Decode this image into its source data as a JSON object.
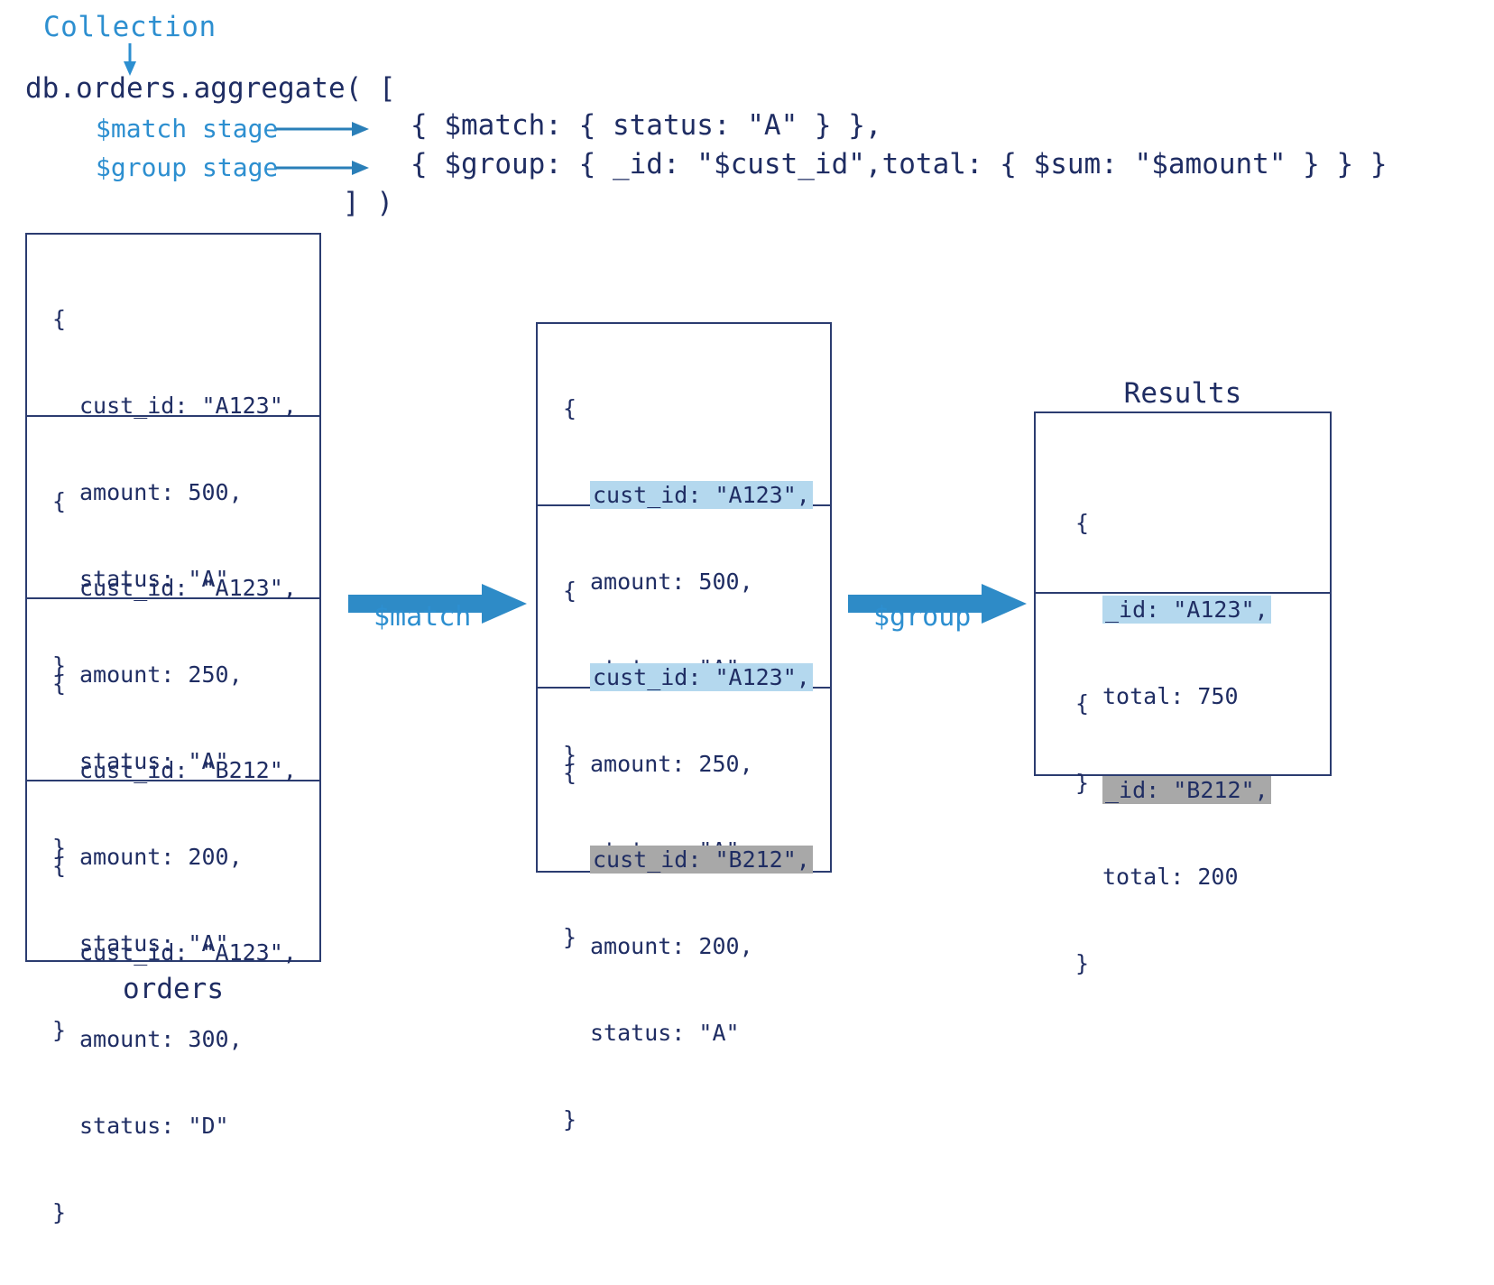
{
  "annotations": {
    "collection_label": "Collection",
    "match_stage_note": "$match stage",
    "group_stage_note": "$group stage"
  },
  "code": {
    "main": "db.orders.aggregate( [",
    "match_stage": "{ $match: { status: \"A\" } },",
    "group_stage": "{ $group: { _id: \"$cust_id\",total: { $sum: \"$amount\" } } }",
    "closing": "] )"
  },
  "orders": {
    "caption": "orders",
    "documents": [
      {
        "open": "{",
        "lines": [
          "cust_id: \"A123\",",
          "amount: 500,",
          "status: \"A\""
        ],
        "close": "}"
      },
      {
        "open": "{",
        "lines": [
          "cust_id: \"A123\",",
          "amount: 250,",
          "status: \"A\""
        ],
        "close": "}"
      },
      {
        "open": "{",
        "lines": [
          "cust_id: \"B212\",",
          "amount: 200,",
          "status: \"A\""
        ],
        "close": "}"
      },
      {
        "open": "{",
        "lines": [
          "cust_id: \"A123\",",
          "amount: 300,",
          "status: \"D\""
        ],
        "close": "}"
      }
    ]
  },
  "matched": {
    "documents": [
      {
        "open": "{",
        "highlight": "cust_id: \"A123\",",
        "highlight_color": "blue",
        "lines": [
          "amount: 500,",
          "status: \"A\""
        ],
        "close": "}"
      },
      {
        "open": "{",
        "highlight": "cust_id: \"A123\",",
        "highlight_color": "blue",
        "lines": [
          "amount: 250,",
          "status: \"A\""
        ],
        "close": "}"
      },
      {
        "open": "{",
        "highlight": "cust_id: \"B212\",",
        "highlight_color": "gray",
        "lines": [
          "amount: 200,",
          "status: \"A\""
        ],
        "close": "}"
      }
    ]
  },
  "results": {
    "caption": "Results",
    "documents": [
      {
        "open": "{",
        "highlight": "_id: \"A123\",",
        "highlight_color": "blue",
        "lines": [
          "total: 750"
        ],
        "close": "}"
      },
      {
        "open": "{",
        "highlight": "_id: \"B212\",",
        "highlight_color": "gray",
        "lines": [
          "total: 200"
        ],
        "close": "}"
      }
    ]
  },
  "stage_arrows": {
    "match_label": "$match",
    "group_label": "$group"
  },
  "colors": {
    "text_navy": "#1f2d63",
    "accent_blue": "#2d8fd0",
    "border_navy": "#2b3c70",
    "highlight_blue": "#b4d8ee",
    "highlight_gray": "#a8a8a8"
  }
}
